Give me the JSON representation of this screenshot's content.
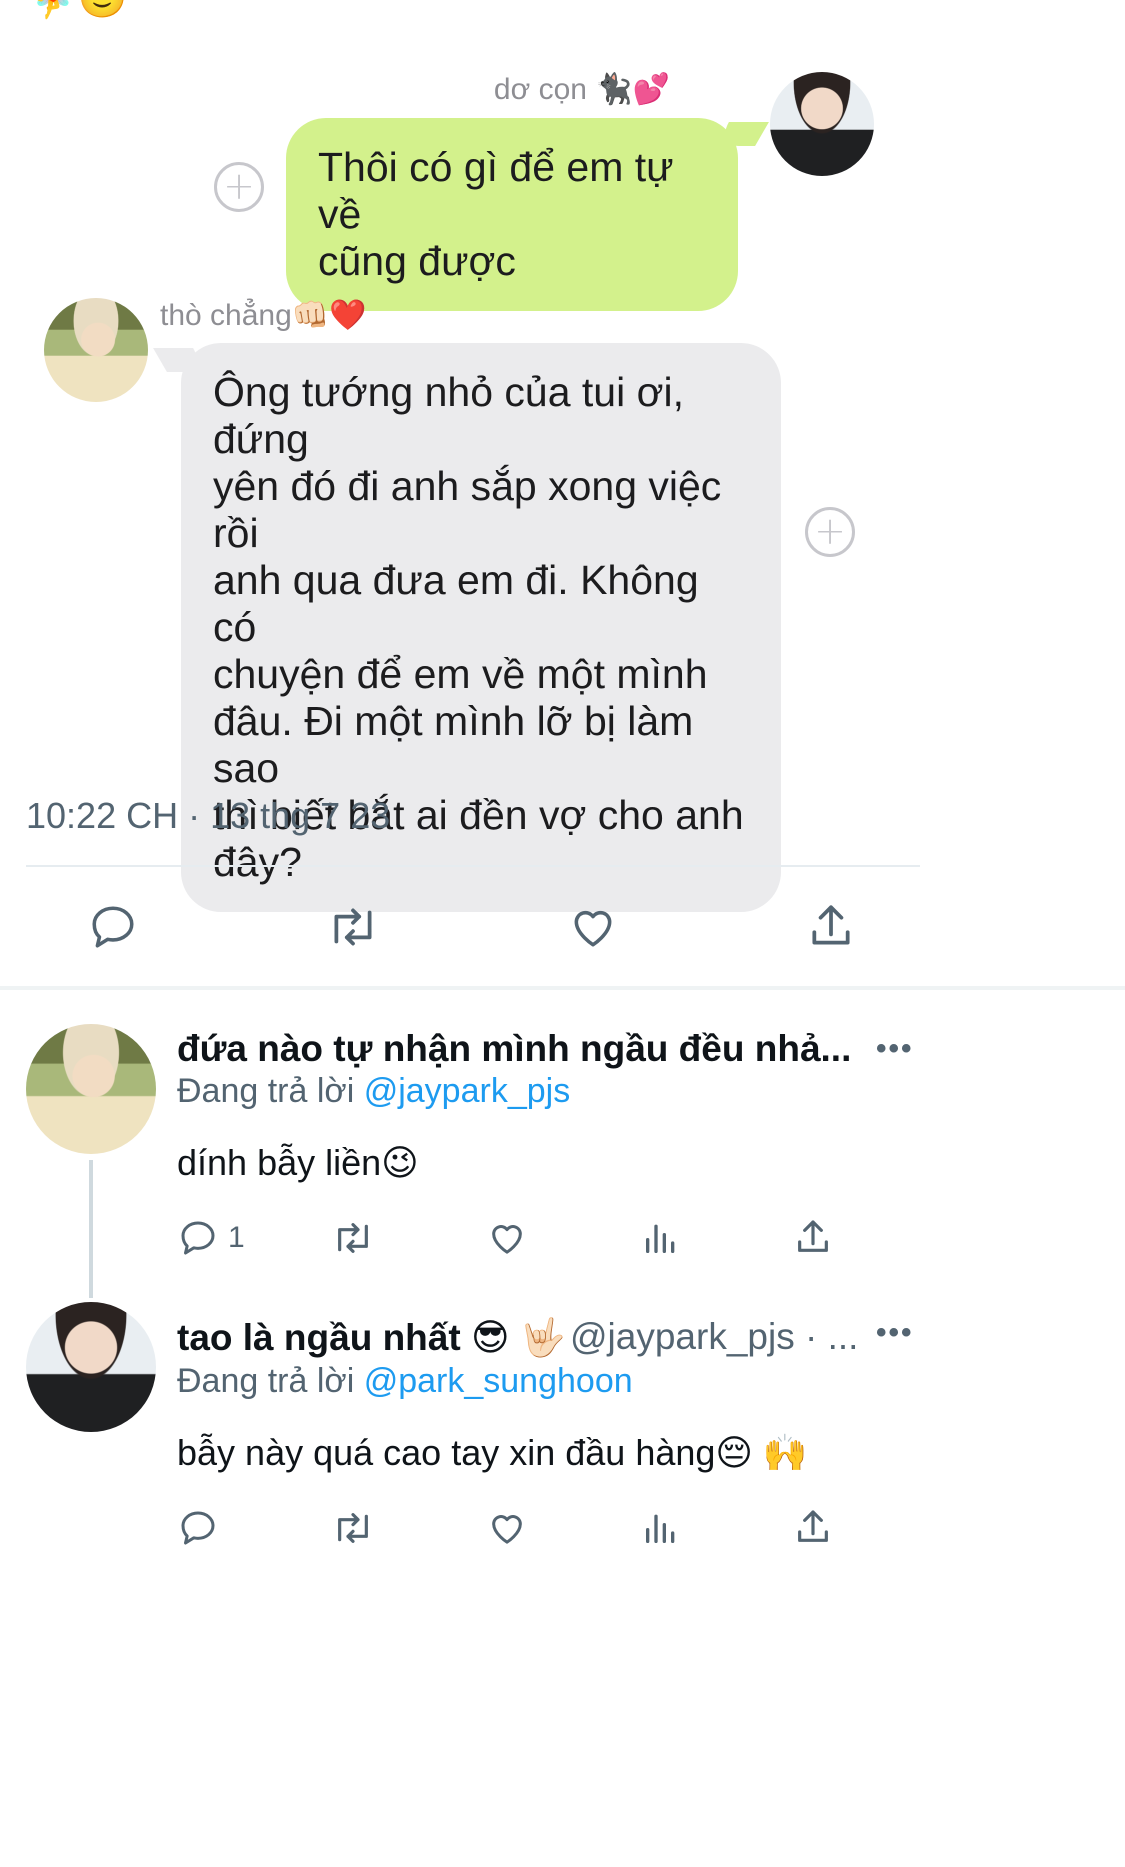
{
  "top_emojis": "🧚🙂",
  "chat": {
    "messages": [
      {
        "sender": "dơ cọn 🐈‍⬛💕",
        "text_lines": [
          "Thôi có gì để em tự về",
          "cũng được"
        ]
      },
      {
        "sender": "thò chẳng👊🏻❤️",
        "text_lines": [
          "Ông tướng nhỏ của tui ơi, đứng",
          "yên đó đi anh sắp xong việc rồi",
          "anh qua đưa em đi. Không có",
          "chuyện để em về một mình",
          "đâu. Đi một mình lỡ bị làm sao",
          "thì biết bắt ai đền vợ cho anh",
          "đây?"
        ]
      }
    ],
    "add_icon": "+"
  },
  "tweet": {
    "timestamp": "10:22 CH · 13 thg 7 23",
    "actions": [
      "reply-icon",
      "retweet-icon",
      "like-icon",
      "share-icon"
    ]
  },
  "replies": [
    {
      "name": "đứa nào tự nhận mình ngầu đều nhả...",
      "handle": "",
      "replying_prefix": "Đang trả lời ",
      "replying_to": "@jaypark_pjs",
      "text": "dính bẫy liền😉",
      "reply_count": "1",
      "more": "•••"
    },
    {
      "name": "tao là ngầu nhất 😎 🤟🏻",
      "handle": "@jaypark_pjs · ...",
      "replying_prefix": "Đang trả lời ",
      "replying_to": "@park_sunghoon",
      "text": "bẫy này quá cao tay xin đầu hàng😔 🙌",
      "reply_count": "",
      "more": "•••"
    }
  ],
  "colors": {
    "bubble_green": "#d3f18c",
    "bubble_gray": "#ebebed",
    "mention_blue": "#1d9bf0",
    "secondary_text": "#536471"
  }
}
